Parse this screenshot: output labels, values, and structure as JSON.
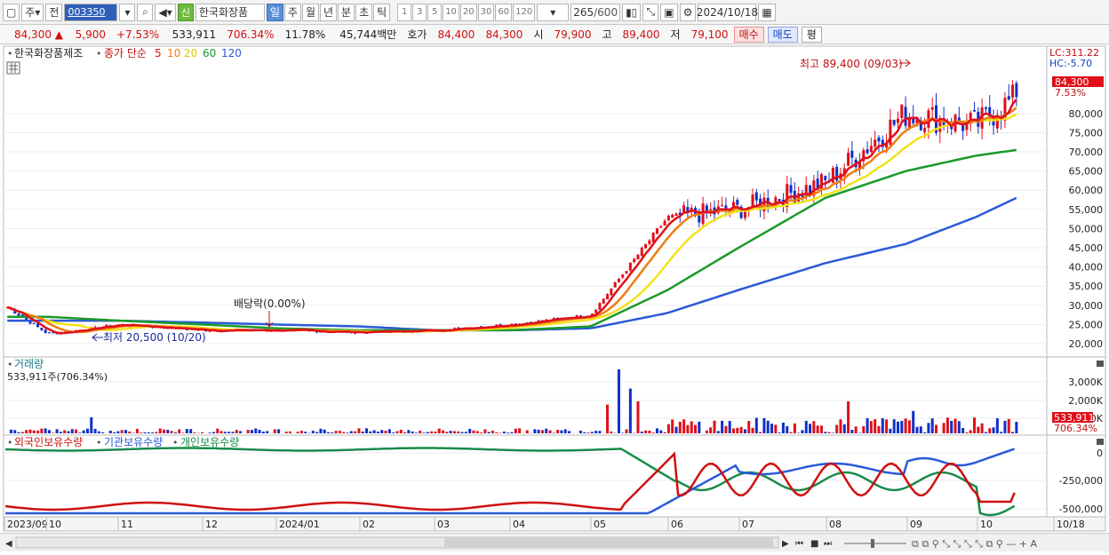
{
  "toolbar": {
    "market": "주",
    "prev": "전",
    "code": "003350",
    "new_tag": "신",
    "name": "한국화장품",
    "periods": [
      {
        "label": "일",
        "active": true
      },
      {
        "label": "주",
        "active": false
      },
      {
        "label": "월",
        "active": false
      },
      {
        "label": "년",
        "active": false
      },
      {
        "label": "분",
        "active": false
      },
      {
        "label": "초",
        "active": false
      },
      {
        "label": "틱",
        "active": false
      }
    ],
    "intervals": [
      "1",
      "3",
      "5",
      "10",
      "20",
      "30",
      "60",
      "120"
    ],
    "count": "265",
    "count_max": "/600",
    "date": "2024/10/18"
  },
  "quote": {
    "price": "84,300 ▲",
    "change": "5,900",
    "change_pct": "+7.53%",
    "volume": "533,911",
    "volume_pct": "706.34%",
    "turnover": "11.78%",
    "amount": "45,744백만",
    "ask_label": "호가",
    "ask": "84,400",
    "bid": "84,300",
    "open_label": "시",
    "open": "79,900",
    "high_label": "고",
    "high": "89,400",
    "low_label": "저",
    "low": "79,100",
    "buy_btn": "매수",
    "sell_btn": "매도",
    "eval_btn": "평"
  },
  "price_panel": {
    "legend_name": "한국화장품제조",
    "legend_ma": "종가 단순",
    "ma_labels": [
      "5",
      "10",
      "20",
      "60",
      "120"
    ],
    "ma_colors": [
      "#e0101a",
      "#f07c10",
      "#f2e21a",
      "#1a9a2a",
      "#2a5ad8"
    ],
    "high_annotation": "최고 89,400 (09/03)",
    "low_annotation": "최저 20,500 (10/20)",
    "dividend_annotation": "배당락(0.00%)",
    "lc": "LC:311.22",
    "hc": "HC:-5.70",
    "current_price": "84,300",
    "current_pct": "7.53%",
    "y_ticks": [
      "80,000",
      "75,000",
      "70,000",
      "65,000",
      "60,000",
      "55,000",
      "50,000",
      "45,000",
      "40,000",
      "35,000",
      "30,000",
      "25,000",
      "20,000"
    ]
  },
  "volume_panel": {
    "title": "거래량",
    "value": "533,911주(706.34%)",
    "y_ticks": [
      "3,000K",
      "2,000K",
      "1,000K"
    ],
    "current": "533,911",
    "current_pct": "706.34%"
  },
  "holding_panel": {
    "legend": [
      {
        "label": "외국인보유수량",
        "color": "#d01010"
      },
      {
        "label": "기관보유수량",
        "color": "#2a5ad8"
      },
      {
        "label": "개인보유수량",
        "color": "#1a8a4a"
      }
    ],
    "y_ticks": [
      "0",
      "-250,000",
      "-500,000"
    ]
  },
  "x_axis": [
    "2023/09",
    "10",
    "11",
    "12",
    "2024/01",
    "02",
    "03",
    "04",
    "05",
    "06",
    "07",
    "08",
    "09",
    "10",
    "10/18"
  ],
  "chart_data": {
    "type": "line",
    "x": [
      "2023/09",
      "2023/10",
      "2023/11",
      "2023/12",
      "2024/01",
      "2024/02",
      "2024/03",
      "2024/04",
      "2024/05",
      "2024/06",
      "2024/07",
      "2024/08",
      "2024/09",
      "2024/10",
      "2024/10/18"
    ],
    "series": [
      {
        "name": "5",
        "values": [
          29500,
          22500,
          25000,
          23500,
          23500,
          23000,
          23500,
          25000,
          27500,
          53000,
          55000,
          62000,
          80000,
          77000,
          84300
        ]
      },
      {
        "name": "60",
        "values": [
          27000,
          27000,
          26000,
          25000,
          24000,
          23500,
          23500,
          23500,
          24500,
          34000,
          45000,
          58000,
          65000,
          69000,
          70500
        ]
      },
      {
        "name": "120",
        "values": [
          26000,
          26000,
          26000,
          25500,
          25000,
          24500,
          23500,
          23500,
          24000,
          28000,
          34000,
          41000,
          46000,
          53000,
          58000
        ]
      }
    ],
    "ylim": [
      17000,
      92000
    ]
  }
}
